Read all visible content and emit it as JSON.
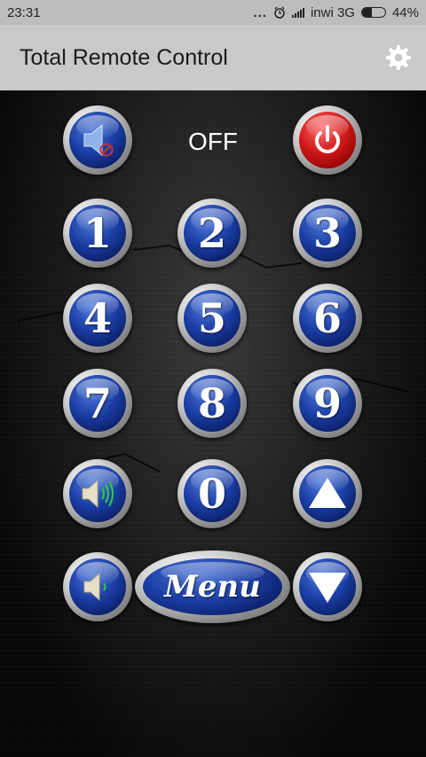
{
  "status_bar": {
    "time": "23:31",
    "dots": "...",
    "carrier": "inwi 3G",
    "battery_percent": "44%",
    "battery_level": 0.44
  },
  "app_bar": {
    "title": "Total Remote Control",
    "settings_icon": "gear-icon"
  },
  "remote": {
    "tv_status": "OFF",
    "digits": [
      "1",
      "2",
      "3",
      "4",
      "5",
      "6",
      "7",
      "8",
      "9",
      "0"
    ],
    "menu_label": "Menu",
    "icons": {
      "mute": "mute-icon",
      "power": "power-icon",
      "volume_up": "volume-up-icon",
      "volume_down": "volume-down-icon",
      "channel_up": "triangle-up-icon",
      "channel_down": "triangle-down-icon"
    }
  }
}
